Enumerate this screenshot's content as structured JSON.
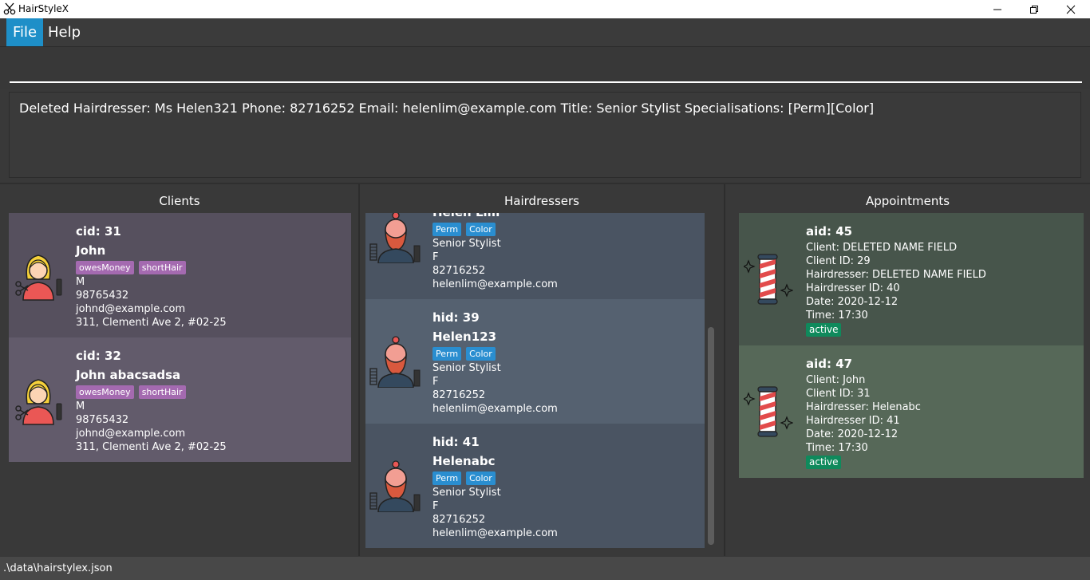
{
  "window": {
    "title": "HairStyleX"
  },
  "menu": {
    "items": [
      {
        "label": "File"
      },
      {
        "label": "Help"
      }
    ]
  },
  "result": {
    "text": "Deleted Hairdresser: Ms Helen321 Phone: 82716252 Email: helenlim@example.com Title: Senior Stylist Specialisations: [Perm][Color]"
  },
  "panels": {
    "clients": "Clients",
    "hairdressers": "Hairdressers",
    "appointments": "Appointments"
  },
  "clients": [
    {
      "id": "cid: 31",
      "name": "John",
      "tags": [
        "owesMoney",
        "shortHair"
      ],
      "gender": "M",
      "phone": "98765432",
      "email": "johnd@example.com",
      "address": "311, Clementi Ave 2, #02-25"
    },
    {
      "id": "cid: 32",
      "name": "John abacsadsa",
      "tags": [
        "owesMoney",
        "shortHair"
      ],
      "gender": "M",
      "phone": "98765432",
      "email": "johnd@example.com",
      "address": "311, Clementi Ave 2, #02-25"
    }
  ],
  "hairdressers": [
    {
      "id": "",
      "name": "Helen Lim",
      "tags": [
        "Perm",
        "Color"
      ],
      "title": "Senior Stylist",
      "gender": "F",
      "phone": "82716252",
      "email": "helenlim@example.com"
    },
    {
      "id": "hid: 39",
      "name": "Helen123",
      "tags": [
        "Perm",
        "Color"
      ],
      "title": "Senior Stylist",
      "gender": "F",
      "phone": "82716252",
      "email": "helenlim@example.com"
    },
    {
      "id": "hid: 41",
      "name": "Helenabc",
      "tags": [
        "Perm",
        "Color"
      ],
      "title": "Senior Stylist",
      "gender": "F",
      "phone": "82716252",
      "email": "helenlim@example.com"
    }
  ],
  "appointments": [
    {
      "id": "aid: 45",
      "client": "Client: DELETED NAME FIELD",
      "client_id": "Client ID: 29",
      "hairdresser": "Hairdresser: DELETED NAME FIELD",
      "hairdresser_id": "Hairdresser ID: 40",
      "date": "Date: 2020-12-12",
      "time": "Time: 17:30",
      "status": "active"
    },
    {
      "id": "aid: 47",
      "client": "Client: John",
      "client_id": "Client ID: 31",
      "hairdresser": "Hairdresser: Helenabc",
      "hairdresser_id": "Hairdresser ID: 41",
      "date": "Date: 2020-12-12",
      "time": "Time: 17:30",
      "status": "active"
    }
  ],
  "status_bar": {
    "path": ".\\data\\hairstylex.json"
  },
  "icons": {
    "app": "scissors-icon",
    "client": "female-client-icon",
    "hairdresser": "bearded-hairdresser-icon",
    "appointment": "barber-pole-icon"
  },
  "colors": {
    "accent": "#1e8fc8",
    "client_tag": "#a46ab0",
    "hairdresser_tag": "#2a8ed0",
    "status_tag": "#0f8a5c"
  }
}
